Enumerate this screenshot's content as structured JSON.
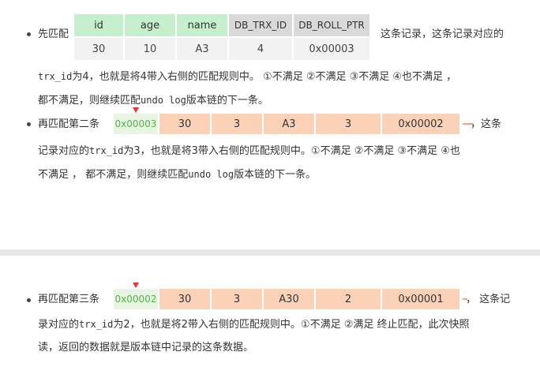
{
  "record": {
    "headers": [
      "id",
      "age",
      "name",
      "DB_TRX_ID",
      "DB_ROLL_PTR"
    ],
    "values": [
      "30",
      "10",
      "A3",
      "4",
      "0x00003"
    ]
  },
  "para1": {
    "lead": "先匹配",
    "tail": "这条记录，这条记录对应的",
    "line2_mono": "trx_id",
    "line2_text": "为4，也就是将4带入右侧的匹配规则中。 ①不满足 ②不满足 ③不满足 ④也不满足 ，",
    "line3_text1": "都不满足，则继续匹配",
    "line3_mono": "undo log",
    "line3_text2": "版本链的下一条。"
  },
  "para2": {
    "lead": "再匹配第二条",
    "node": {
      "trx": "0x00003",
      "cells": [
        "30",
        "3",
        "A3",
        "3",
        "0x00002"
      ]
    },
    "tail": "，这条",
    "line2_text1": "记录对应的",
    "line2_mono": "trx_id",
    "line2_text2": "为3，也就是将3带入右侧的匹配规则中。①不满足 ②不满足 ③不满足 ④也",
    "line3_text1": "不满足 ， 都不满足，则继续匹配",
    "line3_mono": "undo log",
    "line3_text2": "版本链的下一条。"
  },
  "para3": {
    "lead": "再匹配第三条",
    "node": {
      "trx": "0x00002",
      "cells": [
        "30",
        "3",
        "A30",
        "2",
        "0x00001"
      ]
    },
    "tail": "， 这条记",
    "line2_text1": "录对应的",
    "line2_mono": "trx_id",
    "line2_text2": "为2，也就是将2带入右侧的匹配规则中。①不满足 ②满足 终止匹配，此次快照",
    "line3_text": "读，返回的数据就是版本链中记录的这条数据。"
  },
  "colors": {
    "header_green": "#c6efce",
    "header_grey": "#d9d9d9",
    "trx_green_text": "#52b447",
    "cell_orange": "#fbd2b8",
    "pointer_red": "#e53935"
  }
}
